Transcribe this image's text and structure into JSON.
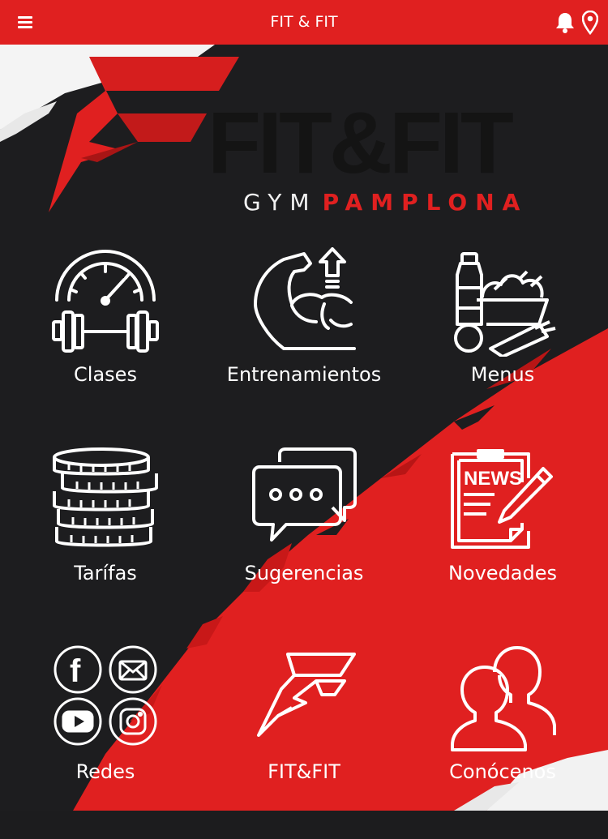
{
  "header": {
    "title": "FIT & FIT"
  },
  "logo": {
    "name": "FIT&FIT",
    "tagline_gray": "GYM",
    "tagline_red": "PAMPLONA"
  },
  "grid": {
    "items": [
      {
        "label": "Clases",
        "icon": "speedometer-dumbbell-icon"
      },
      {
        "label": "Entrenamientos",
        "icon": "flexed-arm-icon"
      },
      {
        "label": "Menus",
        "icon": "food-icon"
      },
      {
        "label": "Tarífas",
        "icon": "coins-stack-icon"
      },
      {
        "label": "Sugerencias",
        "icon": "chat-bubbles-icon"
      },
      {
        "label": "Novedades",
        "icon": "news-clipboard-icon"
      },
      {
        "label": "Redes",
        "icon": "social-networks-icon"
      },
      {
        "label": "FIT&FIT",
        "icon": "fit-logo-icon"
      },
      {
        "label": "Conócenos",
        "icon": "people-icon"
      }
    ]
  },
  "colors": {
    "accent": "#e02020",
    "background": "#1c1c1e",
    "text": "#ffffff"
  }
}
